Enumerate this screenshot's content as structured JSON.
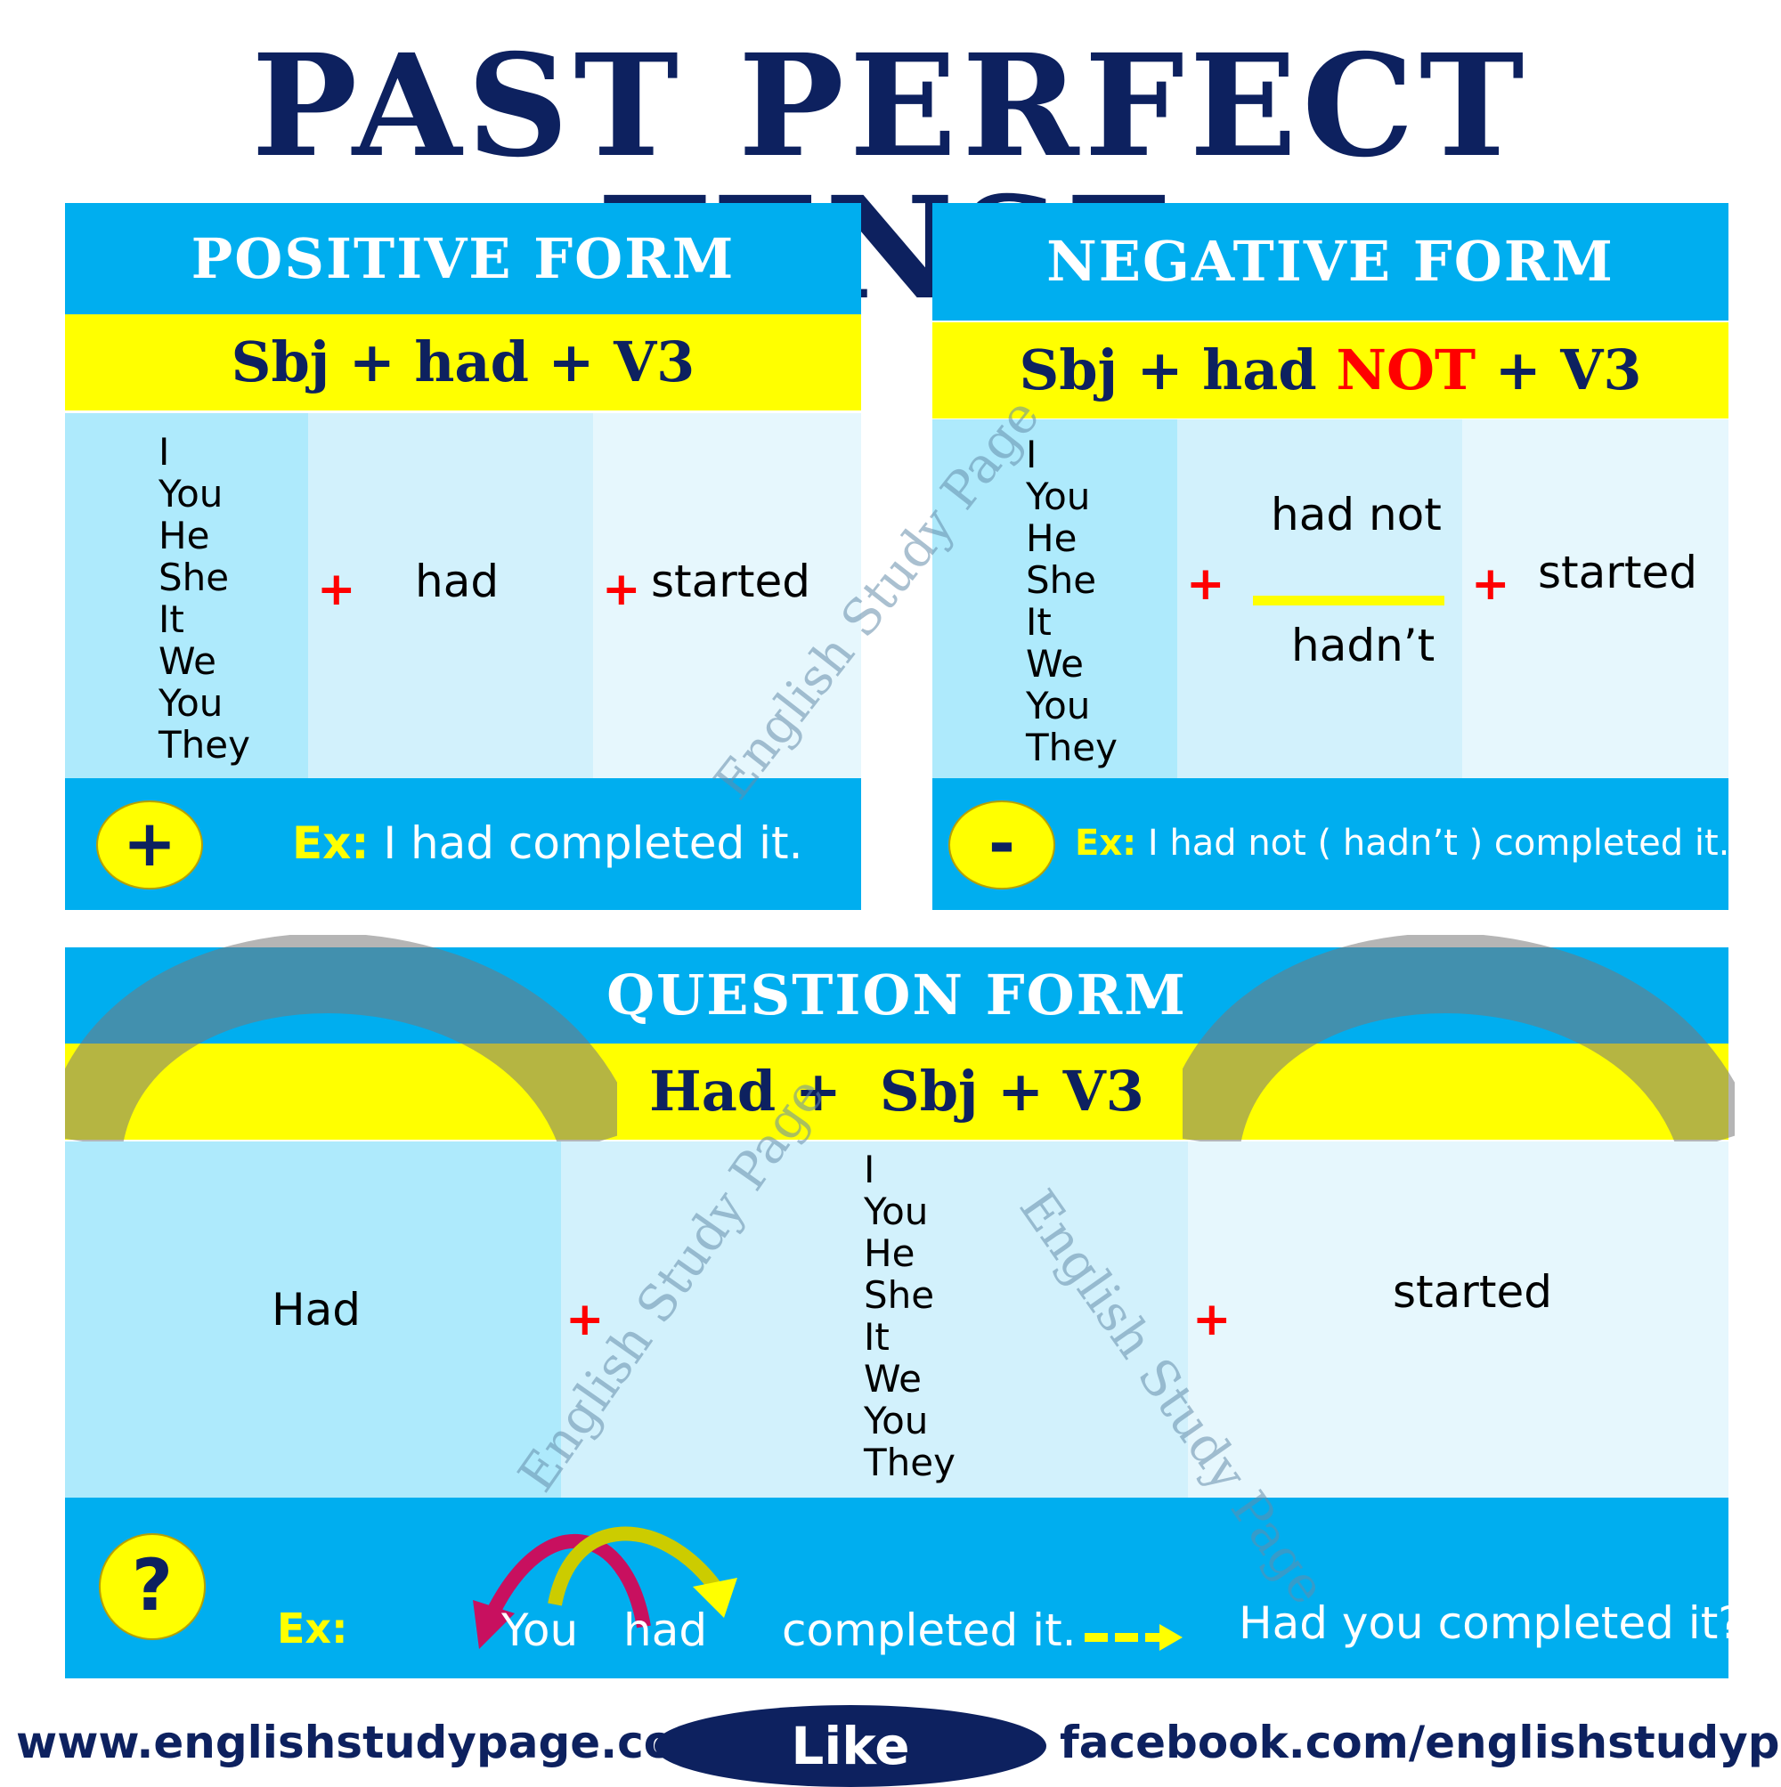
{
  "title": "PAST PERFECT TENSE",
  "subjects": [
    "I",
    "You",
    "He",
    "She",
    "It",
    "We",
    "You",
    "They"
  ],
  "positive": {
    "heading": "POSITIVE FORM",
    "formula": "Sbj + had + V3",
    "aux": "had",
    "verb": "started",
    "plus": "+",
    "badge": "+",
    "example_label": "Ex:",
    "example": "I had completed it."
  },
  "negative": {
    "heading": "NEGATIVE FORM",
    "formula_pre": "Sbj + had ",
    "formula_not": "NOT",
    "formula_post": " + V3",
    "aux_full": "had not",
    "aux_short": "hadn’t",
    "verb": "started",
    "plus": "+",
    "badge": "-",
    "example_label": "Ex:",
    "example": "I had not ( hadn’t ) completed it."
  },
  "question": {
    "heading": "QUESTION FORM",
    "formula": "Had +  Sbj + V3",
    "aux": "Had",
    "verb": "started",
    "plus": "+",
    "badge": "?",
    "example_label": "Ex:",
    "example_word1": "You",
    "example_word2": "had",
    "example_rest": "completed it.",
    "example_result": "Had you completed it?"
  },
  "watermarks": {
    "text": "English Study Page",
    "arch_text": "www.englishstudypage.com"
  },
  "footer": {
    "website": "www.englishstudypage.com",
    "like": "Like",
    "facebook": "facebook.com/englishstudypage"
  },
  "colors": {
    "navy": "#0d215f",
    "header_blue": "#00aeef",
    "yellow": "#ffff00",
    "red": "#ff0000"
  }
}
